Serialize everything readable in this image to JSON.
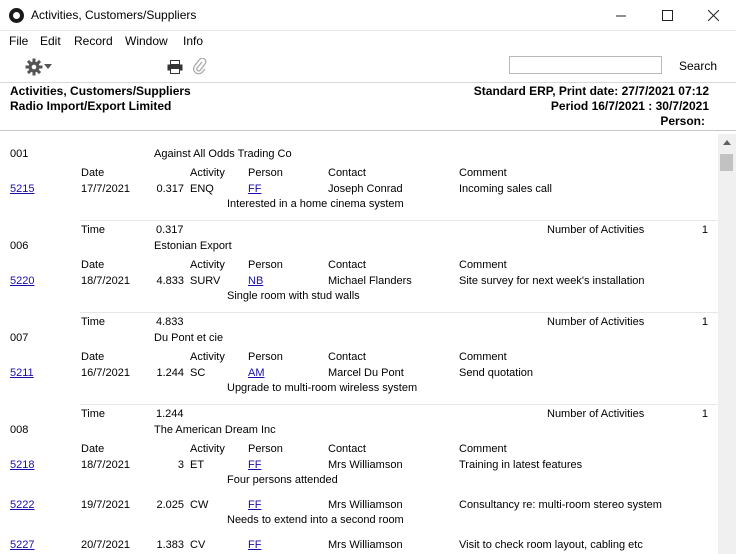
{
  "window": {
    "title": "Activities, Customers/Suppliers",
    "minimize": "—",
    "maximize": "☐",
    "close": "✕"
  },
  "menu": [
    "File",
    "Edit",
    "Record",
    "Window",
    "Info"
  ],
  "toolbar": {
    "search_value": "",
    "search_label": "Search",
    "icons": [
      "gear-icon",
      "printer-icon",
      "paperclip-icon"
    ]
  },
  "header": {
    "report_name": "Activities, Customers/Suppliers",
    "company": "Radio Import/Export Limited",
    "print_info": "Standard ERP, Print date: 27/7/2021 07:12",
    "period": "Period  16/7/2021 : 30/7/2021",
    "person": "Person:"
  },
  "labels": {
    "date": "Date",
    "activity": "Activity",
    "person": "Person",
    "contact": "Contact",
    "comment": "Comment",
    "time": "Time",
    "num_activities": "Number of Activities"
  },
  "groups": [
    {
      "code": "001",
      "name": "Against All Odds Trading Co",
      "activities": [
        {
          "no": "5215",
          "date": "17/7/2021",
          "time": "0.317",
          "type": "ENQ",
          "person": "FF",
          "contact": "Joseph Conrad",
          "comment": "Incoming sales call",
          "text": "Interested in a home cinema system"
        }
      ],
      "total_time": "0.317",
      "count": "1"
    },
    {
      "code": "006",
      "name": "Estonian Export",
      "activities": [
        {
          "no": "5220",
          "date": "18/7/2021",
          "time": "4.833",
          "type": "SURV",
          "person": "NB",
          "contact": "Michael Flanders",
          "comment": "Site survey for next week's installation",
          "text": "Single room with stud walls"
        }
      ],
      "total_time": "4.833",
      "count": "1"
    },
    {
      "code": "007",
      "name": "Du Pont et cie",
      "activities": [
        {
          "no": "5211",
          "date": "16/7/2021",
          "time": "1.244",
          "type": "SC",
          "person": "AM",
          "contact": "Marcel Du Pont",
          "comment": "Send quotation",
          "text": "Upgrade to multi-room wireless system"
        }
      ],
      "total_time": "1.244",
      "count": "1"
    },
    {
      "code": "008",
      "name": "The American Dream Inc",
      "activities": [
        {
          "no": "5218",
          "date": "18/7/2021",
          "time": "3",
          "type": "ET",
          "person": "FF",
          "contact": "Mrs Williamson",
          "comment": "Training in latest features",
          "text": "Four persons attended"
        },
        {
          "no": "5222",
          "date": "19/7/2021",
          "time": "2.025",
          "type": "CW",
          "person": "FF",
          "contact": "Mrs Williamson",
          "comment": "Consultancy re: multi-room stereo system",
          "text": "Needs to extend into a second room"
        },
        {
          "no": "5227",
          "date": "20/7/2021",
          "time": "1.383",
          "type": "CV",
          "person": "FF",
          "contact": "Mrs Williamson",
          "comment": "Visit to check room layout, cabling etc",
          "text": ""
        }
      ]
    }
  ]
}
